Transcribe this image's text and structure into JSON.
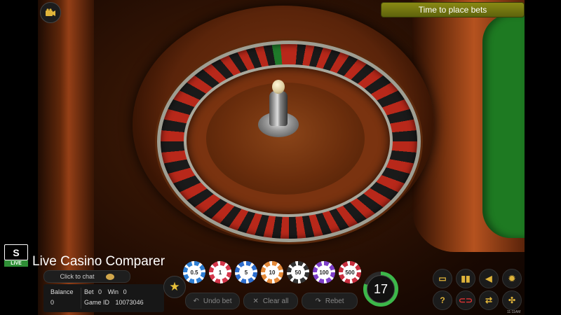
{
  "game": {
    "status_text": "Time to place bets",
    "timer_value": "17",
    "timer_progress_fraction": 0.8,
    "clock": "11:11AM"
  },
  "brand": {
    "logo_letters": "S",
    "logo_badge": "LIVE",
    "name": "Live Casino Comparer"
  },
  "chat": {
    "label": "Click to chat"
  },
  "account": {
    "balance_label": "Balance",
    "balance_value": "0",
    "bet_label": "Bet",
    "bet_value": "0",
    "win_label": "Win",
    "win_value": "0",
    "game_id_label": "Game ID",
    "game_id_value": "10073046"
  },
  "chips": [
    {
      "value": "0.5",
      "color": "#2f7fd4"
    },
    {
      "value": "1",
      "color": "#d4364a"
    },
    {
      "value": "5",
      "color": "#2f6fcf"
    },
    {
      "value": "10",
      "color": "#e58a3a"
    },
    {
      "value": "50",
      "color": "#333333"
    },
    {
      "value": "100",
      "color": "#7e3fc9"
    },
    {
      "value": "500",
      "color": "#c92f3f"
    }
  ],
  "actions": {
    "undo": "Undo bet",
    "clear": "Clear all",
    "rebet": "Rebet"
  },
  "icons": {
    "camera": "camera-icon",
    "star": "star-icon",
    "statistics": "bar-chart-icon",
    "sound": "speaker-icon",
    "settings": "gear-icon",
    "help": "question-icon",
    "racetrack": "racetrack-icon",
    "swap": "swap-icon",
    "fullscreen": "fullscreen-icon",
    "display": "monitor-icon"
  },
  "colors": {
    "banner": "#6f7410",
    "accent_gold": "#e0b43a",
    "timer_green": "#3cb84a",
    "felt_green": "#1e7a22"
  }
}
